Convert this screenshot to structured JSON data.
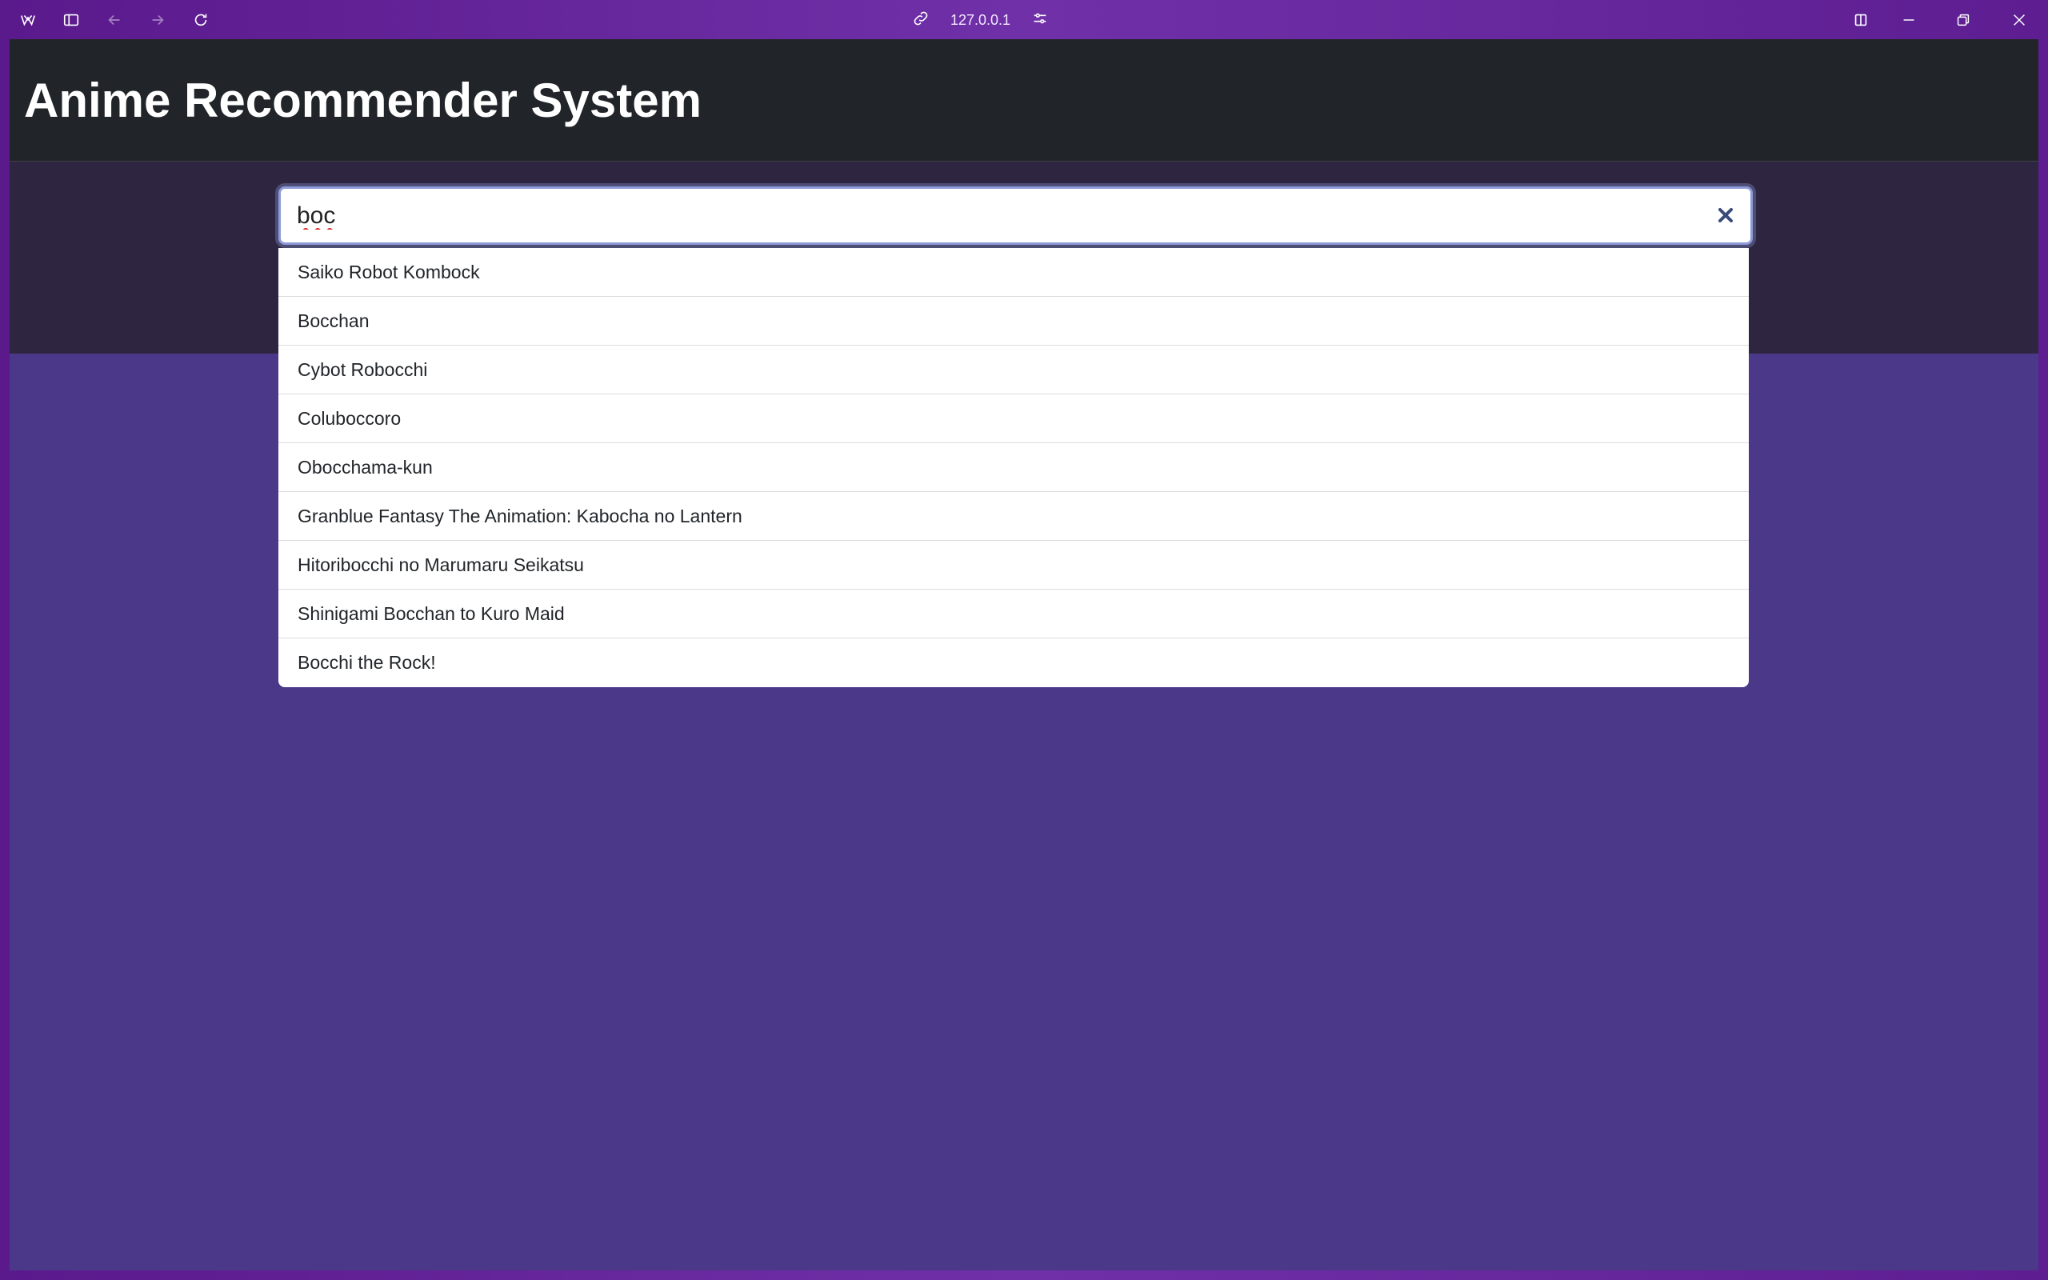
{
  "browser": {
    "url": "127.0.0.1",
    "icons": [
      "app-logo-icon",
      "sidebar-toggle-icon",
      "back-icon",
      "forward-icon",
      "reload-icon",
      "link-icon",
      "site-settings-icon",
      "split-view-icon",
      "minimize-icon",
      "restore-icon",
      "close-window-icon"
    ]
  },
  "header": {
    "title": "Anime Recommender System"
  },
  "search": {
    "value": "boc",
    "clear_icon": "close-icon"
  },
  "results": [
    "Saiko Robot Kombock",
    "Bocchan",
    "Cybot Robocchi",
    "Coluboccoro",
    "Obocchama-kun",
    "Granblue Fantasy The Animation: Kabocha no Lantern",
    "Hitoribocchi no Marumaru Seikatsu",
    "Shinigami Bocchan to Kuro Maid",
    "Bocchi the Rock!"
  ],
  "colors": {
    "navbar": "#212529",
    "hero": "#2e2640",
    "page": "#4b3889",
    "chrome": "#6a24a0"
  }
}
